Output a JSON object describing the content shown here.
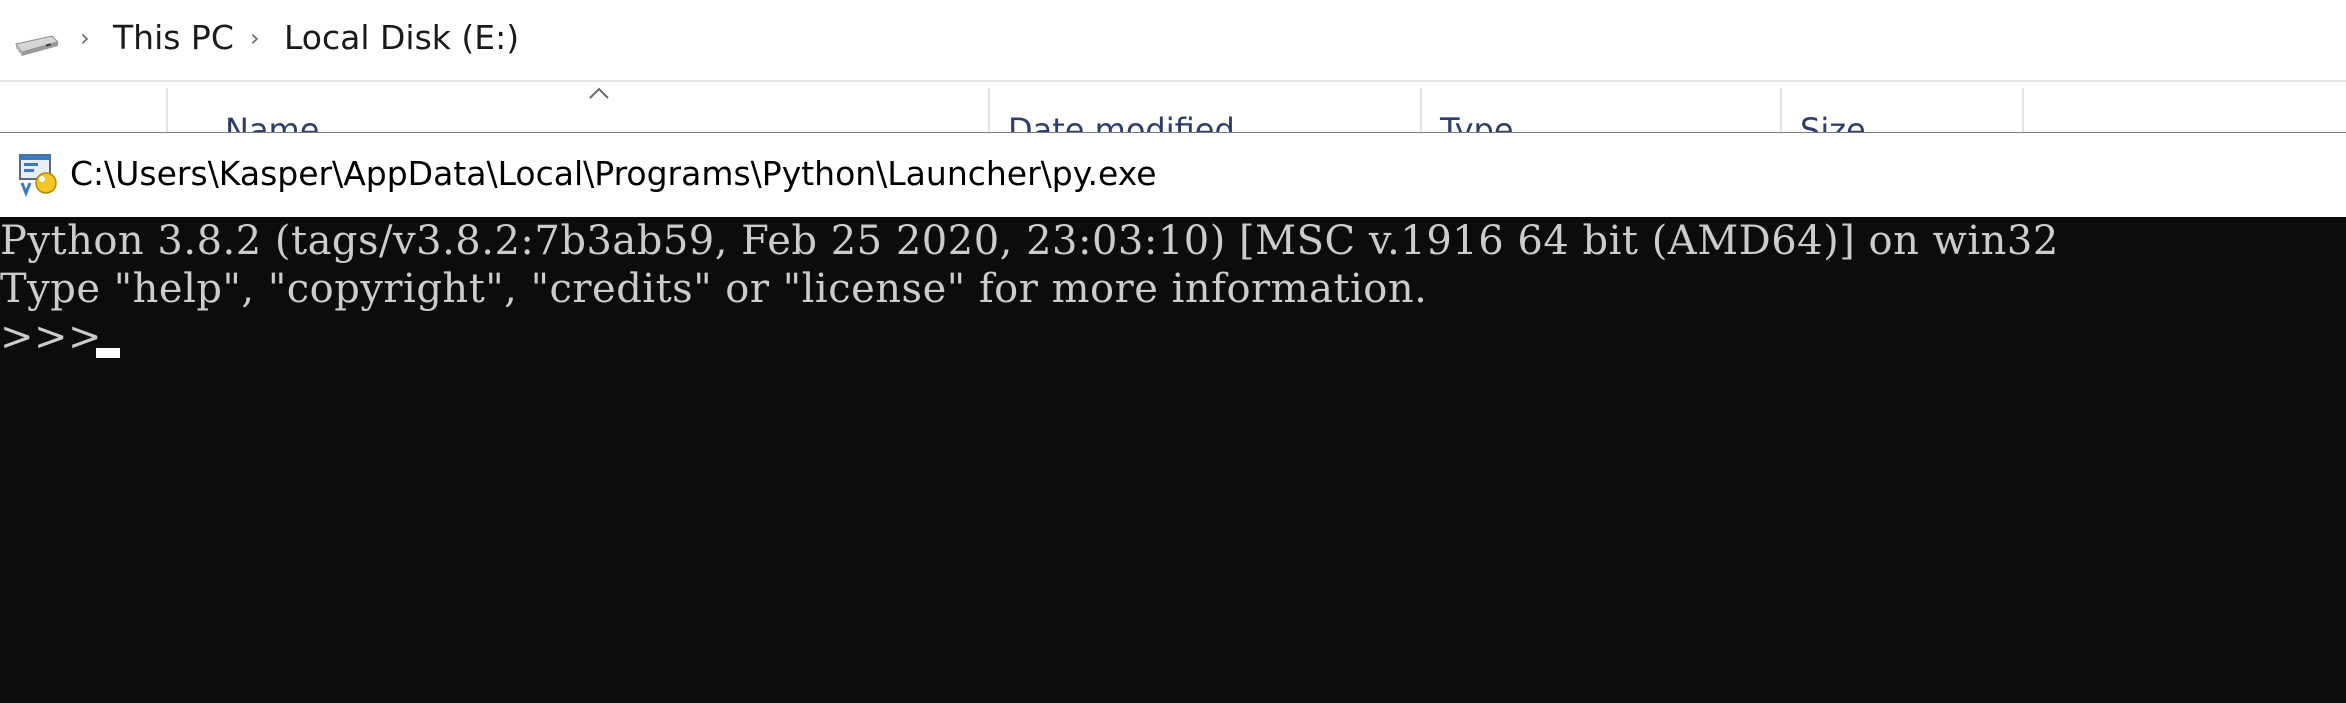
{
  "explorer": {
    "breadcrumb": [
      "This PC",
      "Local Disk (E:)"
    ],
    "columns": [
      "Name",
      "Date modified",
      "Type",
      "Size"
    ],
    "icons": {
      "drive": "drive-icon",
      "separator": "chevron-right-icon",
      "sort": "sort-up-icon"
    }
  },
  "console": {
    "title": "C:\\Users\\Kasper\\AppData\\Local\\Programs\\Python\\Launcher\\py.exe",
    "lines": [
      "Python 3.8.2 (tags/v3.8.2:7b3ab59, Feb 25 2020, 23:03:10) [MSC v.1916 64 bit (AMD64)] on win32",
      "Type \"help\", \"copyright\", \"credits\" or \"license\" for more information.",
      ">>> "
    ],
    "colors": {
      "background": "#0c0c0c",
      "text": "#cccccc",
      "cursor": "#ffffff"
    },
    "icon": "python-launcher-icon"
  }
}
